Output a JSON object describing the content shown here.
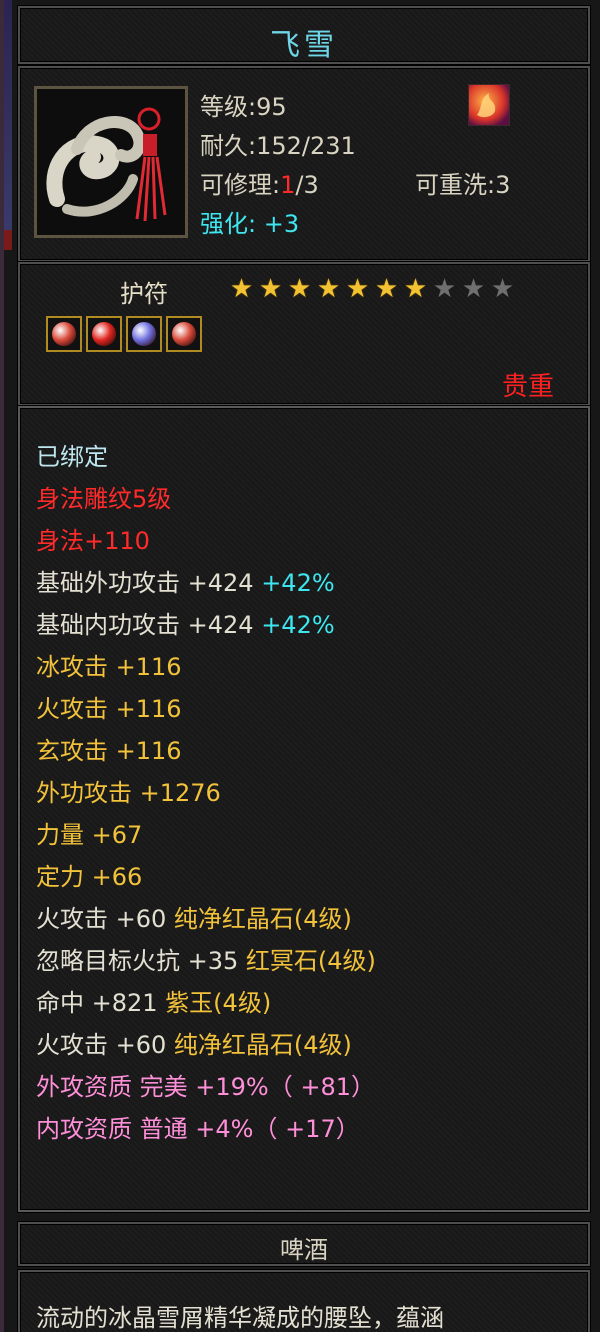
{
  "item": {
    "name": "飞雪",
    "level_label": "等级:",
    "level": "95",
    "durability_label": "耐久:",
    "durability": "152/231",
    "repair_label": "可修理:",
    "repair_used": "1",
    "repair_total": "/3",
    "rewash_label": "可重洗:",
    "rewash": "3",
    "enhance_label": "强化:",
    "enhance": "+3",
    "icon": "jade-pendant-icon",
    "badge_icon": "flame-seal-icon"
  },
  "amulet": {
    "label": "护符",
    "stars_total": 10,
    "stars_filled": 7,
    "gems": [
      {
        "icon": "green-red-gem-icon",
        "color": "#d84a3a"
      },
      {
        "icon": "red-gem-icon",
        "color": "#e0261f"
      },
      {
        "icon": "purple-gem-icon",
        "color": "#6f6fe0"
      },
      {
        "icon": "green-red-gem-icon",
        "color": "#d84a3a"
      }
    ],
    "rarity": "贵重"
  },
  "properties": [
    {
      "text": "已绑定",
      "color": "bound"
    },
    {
      "text": "身法雕纹5级",
      "color": "red"
    },
    {
      "text": "身法+110",
      "color": "red"
    },
    {
      "text": "基础外功攻击  +424 ",
      "extra": "+42%",
      "color": "white"
    },
    {
      "text": "基础内功攻击  +424 ",
      "extra": "+42%",
      "color": "white"
    },
    {
      "text": "冰攻击  +116",
      "color": "yellow"
    },
    {
      "text": "火攻击  +116",
      "color": "yellow"
    },
    {
      "text": "玄攻击  +116",
      "color": "yellow"
    },
    {
      "text": "外功攻击  +1276",
      "color": "yellow"
    },
    {
      "text": "力量  +67",
      "color": "yellow"
    },
    {
      "text": "定力  +66",
      "color": "yellow"
    },
    {
      "text": "火攻击  +60 ",
      "extra": "纯净红晶石(4级)",
      "extra_color": "yellow",
      "color": "white"
    },
    {
      "text": "忽略目标火抗  +35 ",
      "extra": "红冥石(4级)",
      "extra_color": "yellow",
      "color": "white"
    },
    {
      "text": "命中  +821 ",
      "extra": "紫玉(4级)",
      "extra_color": "yellow",
      "color": "white"
    },
    {
      "text": "火攻击  +60 ",
      "extra": "纯净红晶石(4级)",
      "extra_color": "yellow",
      "color": "white"
    },
    {
      "text": "外攻资质   完美  +19%（ +81）",
      "color": "pink"
    },
    {
      "text": "内攻资质   普通  +4%（ +17）",
      "color": "pink"
    }
  ],
  "secondary_name": "啤酒",
  "description": "流动的冰晶雪屑精华凝成的腰坠，蕴涵"
}
